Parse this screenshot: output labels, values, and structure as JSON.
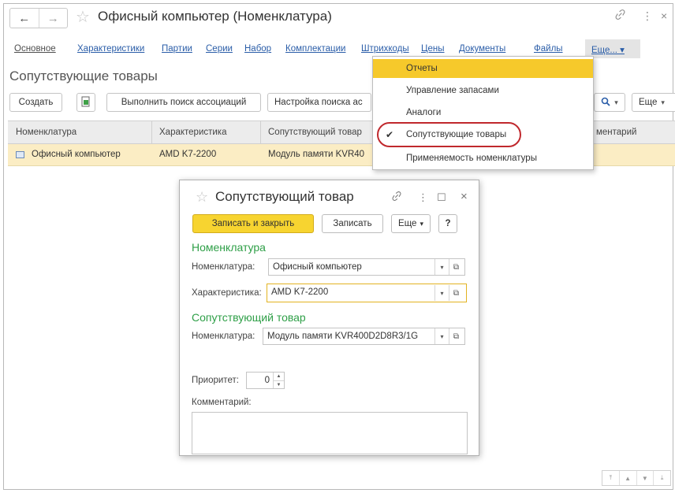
{
  "window": {
    "title": "Офисный компьютер (Номенклатура)",
    "back_icon": "←",
    "forward_icon": "→",
    "star_icon": "☆",
    "link_icon": "🔗",
    "menu_icon": "⋮",
    "close_icon": "×"
  },
  "tabs": [
    "Основное",
    "Характеристики",
    "Партии",
    "Серии",
    "Набор",
    "Комплектации",
    "Штрихкоды",
    "Цены",
    "Документы",
    "Файлы"
  ],
  "tabs_more": "Еще... ▾",
  "section": {
    "title": "Сопутствующие товары"
  },
  "toolbar": {
    "create": "Создать",
    "find_assoc": "Выполнить поиск ассоциаций",
    "assoc_settings": "Настройка поиска ас",
    "search_icon": "🔍",
    "more": "Еще"
  },
  "table": {
    "columns": [
      "Номенклатура",
      "Характеристика",
      "Сопутствующий товар",
      "Комментарий"
    ],
    "col4_visible": "ментарий",
    "row": {
      "nomenclature": "Офисный компьютер",
      "characteristic": "AMD K7-2200",
      "related": "Модуль памяти KVR40"
    }
  },
  "dropdown": {
    "items": [
      "Отчеты",
      "Управление запасами",
      "Аналоги",
      "Сопутствующие товары",
      "Применяемость номенклатуры"
    ],
    "highlighted_index": 0,
    "checked_index": 3,
    "check_mark": "✔"
  },
  "dialog": {
    "title": "Сопутствующий товар",
    "save_close": "Записать и закрыть",
    "save": "Записать",
    "more": "Еще",
    "help": "?",
    "maximize_icon": "☐",
    "group1": "Номенклатура",
    "nomenclature_label": "Номенклатура:",
    "nomenclature_value": "Офисный компьютер",
    "characteristic_label": "Характеристика:",
    "characteristic_value": "AMD K7-2200",
    "group2": "Сопутствующий товар",
    "related_label": "Номенклатура:",
    "related_value": "Модуль памяти KVR400D2D8R3/1G",
    "priority_label": "Приоритет:",
    "priority_value": "0",
    "comment_label": "Комментарий:",
    "comment_value": ""
  },
  "colors": {
    "accent": "#f7d430",
    "highlight_row": "#fbedc4",
    "group_label": "#2e9f47",
    "link": "#2a5da8",
    "circle": "#c0282d"
  }
}
